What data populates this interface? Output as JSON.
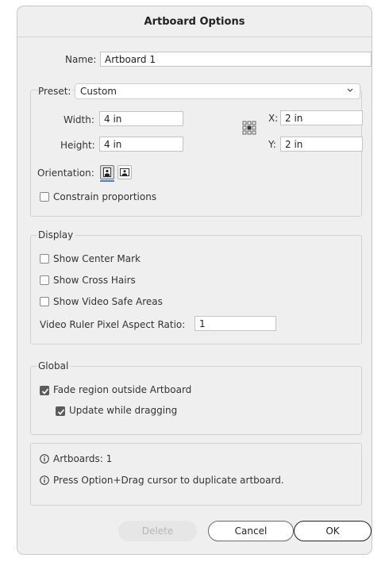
{
  "dialog": {
    "title": "Artboard Options"
  },
  "fields": {
    "name_label": "Name:",
    "name_value": "Artboard 1",
    "preset_label": "Preset:",
    "preset_value": "Custom",
    "width_label": "Width:",
    "width_value": "4 in",
    "height_label": "Height:",
    "height_value": "4 in",
    "x_label": "X:",
    "x_value": "2 in",
    "y_label": "Y:",
    "y_value": "2 in",
    "orientation_label": "Orientation:",
    "orientation_selected": "portrait",
    "constrain_label": "Constrain proportions",
    "constrain_checked": false
  },
  "display": {
    "legend": "Display",
    "show_center_mark": "Show Center Mark",
    "show_cross_hairs": "Show Cross Hairs",
    "show_video_safe": "Show Video Safe Areas",
    "aspect_label": "Video Ruler Pixel Aspect Ratio:",
    "aspect_value": "1"
  },
  "global": {
    "legend": "Global",
    "fade_label": "Fade region outside Artboard",
    "fade_checked": true,
    "update_label": "Update while dragging",
    "update_checked": true
  },
  "info": {
    "artboards": "Artboards: 1",
    "hint": "Press Option+Drag cursor to duplicate artboard."
  },
  "buttons": {
    "delete": "Delete",
    "cancel": "Cancel",
    "ok": "OK"
  },
  "icons": {
    "info": "info-icon",
    "chevron": "chevron-down-icon",
    "reference_point": "reference-point-icon",
    "portrait": "portrait-icon",
    "landscape": "landscape-icon"
  }
}
